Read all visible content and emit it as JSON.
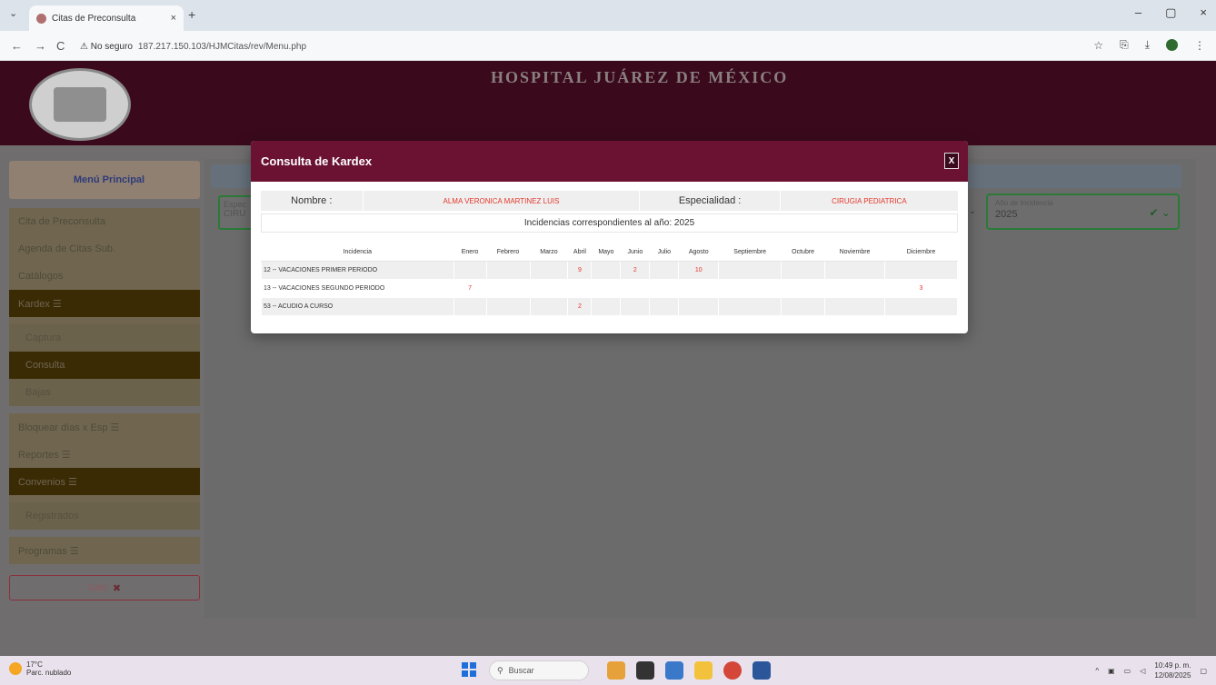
{
  "browser": {
    "tab_title": "Citas de Preconsulta",
    "tab_close": "×",
    "new_tab": "+",
    "tab_menu": "⌄",
    "window_controls": [
      "–",
      "▢",
      "×"
    ],
    "security_label": "⚠ No seguro",
    "url": "187.217.150.103/HJMCitas/rev/Menu.php",
    "back": "←",
    "forward": "→",
    "reload": "C",
    "right_icons": [
      "☆",
      "⎘",
      "⤓",
      "⋮"
    ]
  },
  "header": {
    "title": "HOSPITAL JUÁREZ DE MÉXICO"
  },
  "sidebar": {
    "menu_principal": "Menú Principal",
    "items": {
      "cita": "Cita de Preconsulta",
      "agenda": "Agenda de Citas Sub.",
      "catalogos": "Catálogos",
      "kardex": "Kardex ☰",
      "captura": "Captura",
      "consulta": "Consulta",
      "bajas": "Bajas",
      "bloquear": "Bloquear días x Esp ☰",
      "reportes": "Reportes ☰",
      "convenios": "Convenios ☰",
      "registrados": "Registrados",
      "programas": "Programas ☰",
      "salir": "Salir"
    }
  },
  "form": {
    "espec_label": "Espec",
    "espec_value": "CIRU",
    "year_label": "Año de Incidencia",
    "year_value": "2025"
  },
  "modal": {
    "title": "Consulta de Kardex",
    "close": "X",
    "nombre_label": "Nombre :",
    "nombre_value": "ALMA VERONICA MARTINEZ LUIS",
    "especialidad_label": "Especialidad :",
    "especialidad_value": "CIRUGIA PEDIATRICA",
    "year_caption": "Incidencias correspondientes al año: 2025",
    "columns": [
      "Incidencia",
      "Enero",
      "Febrero",
      "Marzo",
      "Abril",
      "Mayo",
      "Junio",
      "Julio",
      "Agosto",
      "Septiembre",
      "Octubre",
      "Noviembre",
      "Diciembre"
    ],
    "rows": [
      [
        "12 -- VACACIONES PRIMER PERIODO",
        "",
        "",
        "",
        "9",
        "",
        "2",
        "",
        "10",
        "",
        "",
        "",
        ""
      ],
      [
        "13 -- VACACIONES SEGUNDO PERIODO",
        "7",
        "",
        "",
        "",
        "",
        "",
        "",
        "",
        "",
        "",
        "",
        "3"
      ],
      [
        "53 -- ACUDIO A CURSO",
        "",
        "",
        "",
        "2",
        "",
        "",
        "",
        "",
        "",
        "",
        "",
        ""
      ]
    ]
  },
  "taskbar": {
    "temp": "17°C",
    "weather": "Parc. nublado",
    "search": "Buscar",
    "time": "10:49 p. m.",
    "date": "12/08/2025"
  }
}
